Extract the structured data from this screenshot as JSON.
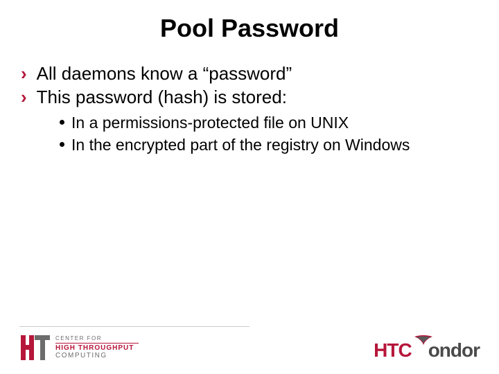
{
  "title": "Pool Password",
  "bullets": [
    {
      "text": "All daemons know a “password”"
    },
    {
      "text": "This password (hash) is stored:"
    }
  ],
  "subbullets": [
    {
      "text": "In a permissions-protected file on UNIX"
    },
    {
      "text": "In the encrypted part of the registry on Windows"
    }
  ],
  "footer": {
    "left": {
      "line1": "CENTER FOR",
      "line2": "HIGH THROUGHPUT",
      "line3": "COMPUTING"
    },
    "right": {
      "part1": "HTC",
      "part2": "ondor"
    }
  }
}
